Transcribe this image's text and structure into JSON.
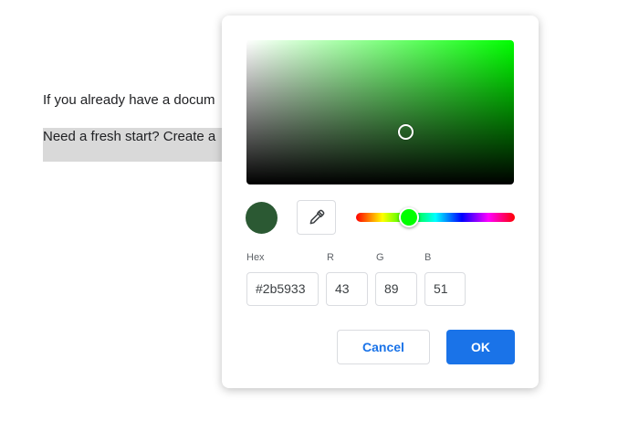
{
  "document": {
    "line1": "If you already have a docum",
    "line2": "Need a fresh start? Create a"
  },
  "color_picker": {
    "current_color": "#2b5933",
    "hue_color": "#00ff00",
    "hue_fraction": 0.333,
    "labels": {
      "hex": "Hex",
      "r": "R",
      "g": "G",
      "b": "B"
    },
    "values": {
      "hex": "#2b5933",
      "r": "43",
      "g": "89",
      "b": "51"
    },
    "cancel_label": "Cancel",
    "ok_label": "OK"
  }
}
